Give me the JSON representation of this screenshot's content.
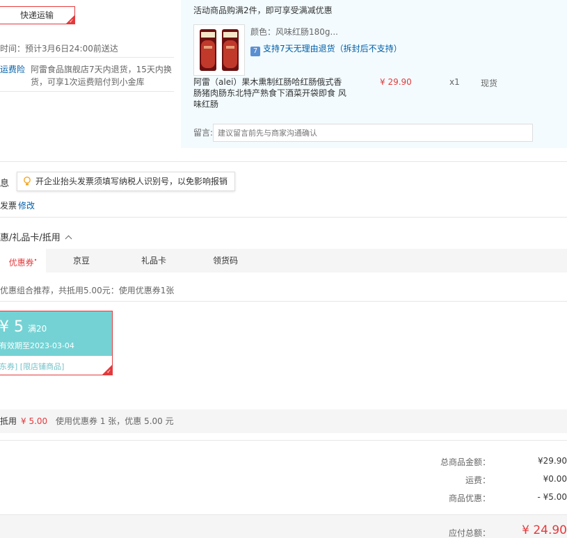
{
  "shipping": {
    "method_label": "快递运输",
    "time_text": "时间：预计3月6日24:00前送达",
    "insurance_label": "运费险",
    "insurance_text": "阿雷食品旗舰店7天内退货，15天内换货，可享1次运费赔付到小金库"
  },
  "goods": {
    "promo_note": "活动商品购满2件，即可享受满减优惠",
    "color_text": "颜色：风味红肠180g...",
    "return_text": "支持7天无理由退货（拆封后不支持）",
    "return_icon": "seven-days-icon",
    "name": "阿雷（alei）果木熏制红肠哈红肠俄式香肠猪肉肠东北特产熟食下酒菜开袋即食 风味红肠",
    "price": "¥ 29.90",
    "qty": "x1",
    "stock": "现货",
    "message_label": "留言:",
    "message_placeholder": "建议留言前先与商家沟通确认"
  },
  "invoice": {
    "title": "息",
    "tip": "开企业抬头发票须填写纳税人识别号，以免影响报销",
    "type": "发票",
    "edit_label": "修改"
  },
  "discounts": {
    "title": "惠/礼品卡/抵用",
    "tabs": [
      {
        "label": "优惠券",
        "active": true,
        "badge": "•"
      },
      {
        "label": "京豆",
        "active": false
      },
      {
        "label": "礼品卡",
        "active": false
      },
      {
        "label": "领货码",
        "active": false
      }
    ],
    "recommend_text": "优惠组合推荐，共抵用5.00元：使用优惠券1张",
    "coupon": {
      "amount": "¥ 5",
      "condition": "满20",
      "valid": "有效期至2023-03-04",
      "tags": "东券] [限店铺商品]",
      "color": "#74d2d4"
    },
    "used_label": "抵用",
    "used_amount": "¥ 5.00",
    "used_desc": "使用优惠券 1 张，优惠 5.00 元"
  },
  "summary": {
    "goods_total_label": "总商品金额：",
    "goods_total": "¥29.90",
    "shipping_label": "运费：",
    "shipping": "¥0.00",
    "discount_label": "商品优惠：",
    "discount": "- ¥5.00",
    "payable_label": "应付总额：",
    "payable": "¥ 24.90"
  }
}
